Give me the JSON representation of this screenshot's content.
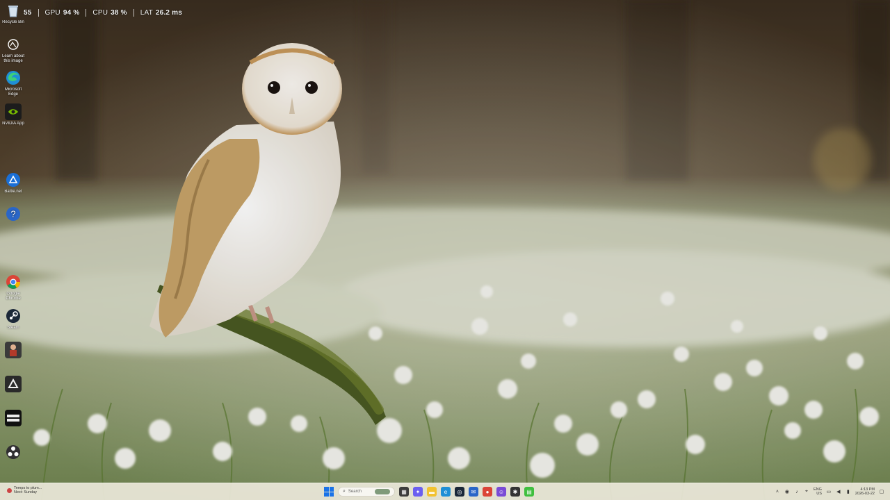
{
  "overlay": {
    "fps_value": "55",
    "gpu_label": "GPU",
    "gpu_value": "94 %",
    "cpu_label": "CPU",
    "cpu_value": "38 %",
    "lat_label": "LAT",
    "lat_value": "26.2 ms"
  },
  "desktop_icons": [
    {
      "label": "Recycle Bin",
      "icon": "recycle-bin-icon"
    },
    {
      "label": "Learn about this image",
      "icon": "camera-icon"
    },
    {
      "label": "Microsoft Edge",
      "icon": "edge-icon"
    },
    {
      "label": "NVIDIA App",
      "icon": "nvidia-icon"
    },
    {
      "label": "Battle.net",
      "icon": "battlenet-icon"
    },
    {
      "label": "",
      "icon": "help-icon"
    },
    {
      "label": "Google Chrome",
      "icon": "chrome-icon"
    },
    {
      "label": "Steam",
      "icon": "steam-icon"
    },
    {
      "label": "",
      "icon": "game-icon"
    },
    {
      "label": "",
      "icon": "app-icon"
    },
    {
      "label": "",
      "icon": "call-of-duty-icon"
    },
    {
      "label": "",
      "icon": "obs-icon"
    }
  ],
  "taskbar": {
    "weather_line1": "Temps to plum...",
    "weather_line2": "Next: Sunday",
    "search_placeholder": "Search",
    "lang_line1": "ENG",
    "lang_line2": "US",
    "time": "4:13 PM",
    "date": "2026-03-22"
  },
  "colors": {
    "start_blue": "#1a73e8",
    "taskbar_bg": "#ebe8da"
  }
}
